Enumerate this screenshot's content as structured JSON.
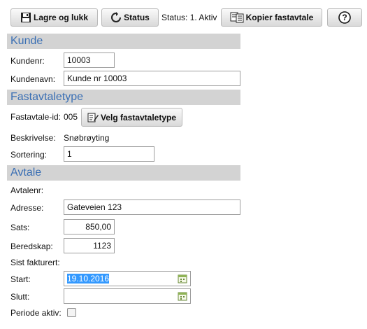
{
  "toolbar": {
    "save_label": "Lagre og lukk",
    "status_label": "Status",
    "status_text": "Status: 1. Aktiv",
    "copy_label": "Kopier fastavtale",
    "help_label": "?"
  },
  "kunde": {
    "heading": "Kunde",
    "kundenr_label": "Kundenr:",
    "kundenr_value": "10003",
    "kundenavn_label": "Kundenavn:",
    "kundenavn_value": "Kunde nr 10003"
  },
  "fastavtaletype": {
    "heading": "Fastavtaletype",
    "id_label": "Fastavtale-id:",
    "id_value": "005",
    "choose_label": "Velg fastavtaletype",
    "beskrivelse_label": "Beskrivelse:",
    "beskrivelse_value": "Snøbrøyting",
    "sortering_label": "Sortering:",
    "sortering_value": "1"
  },
  "avtale": {
    "heading": "Avtale",
    "avtalenr_label": "Avtalenr:",
    "adresse_label": "Adresse:",
    "adresse_value": "Gateveien 123",
    "sats_label": "Sats:",
    "sats_value": "850,00",
    "beredskap_label": "Beredskap:",
    "beredskap_value": "1123",
    "sist_fakturert_label": "Sist fakturert:",
    "start_label": "Start:",
    "start_value": "19.10.2016",
    "slutt_label": "Slutt:",
    "slutt_value": "",
    "periode_label": "Periode aktiv:",
    "periode_checked": false
  },
  "icons": {
    "save": "floppy-disk-icon",
    "status": "refresh-icon",
    "copy": "copy-document-icon",
    "help": "question-circle-icon",
    "choose": "edit-document-icon",
    "calendar": "calendar-icon"
  }
}
